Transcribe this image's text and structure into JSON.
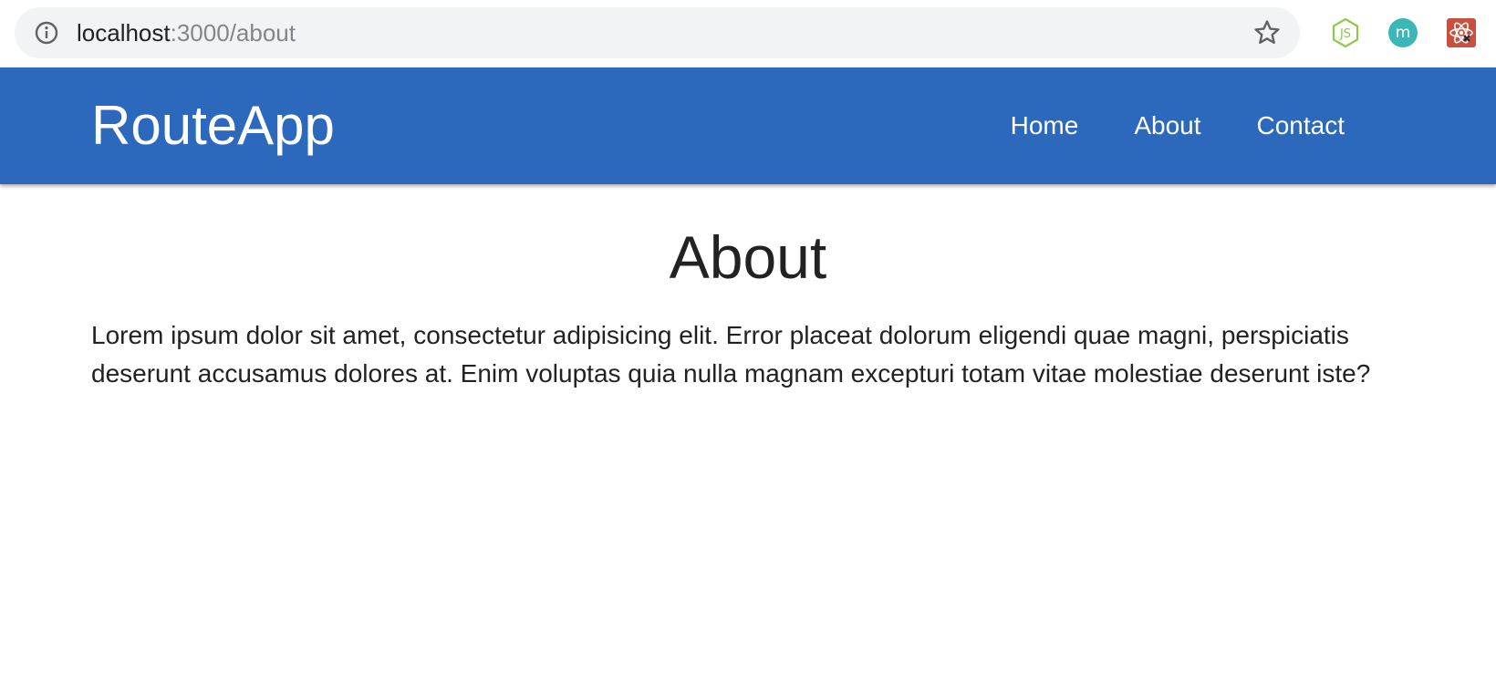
{
  "browser": {
    "url_host": "localhost",
    "url_rest": ":3000/about",
    "icons": [
      "info-icon",
      "star-icon",
      "nodejs-extension-icon",
      "m-extension-icon",
      "react-devtools-extension-icon"
    ]
  },
  "navbar": {
    "brand": "RouteApp",
    "links": [
      {
        "label": "Home"
      },
      {
        "label": "About"
      },
      {
        "label": "Contact"
      }
    ],
    "color": "#2c68bc"
  },
  "page": {
    "title": "About",
    "body": "Lorem ipsum dolor sit amet, consectetur adipisicing elit. Error placeat dolorum eligendi quae magni, perspiciatis deserunt accusamus dolores at. Enim voluptas quia nulla magnam excepturi totam vitae molestiae deserunt iste?"
  }
}
